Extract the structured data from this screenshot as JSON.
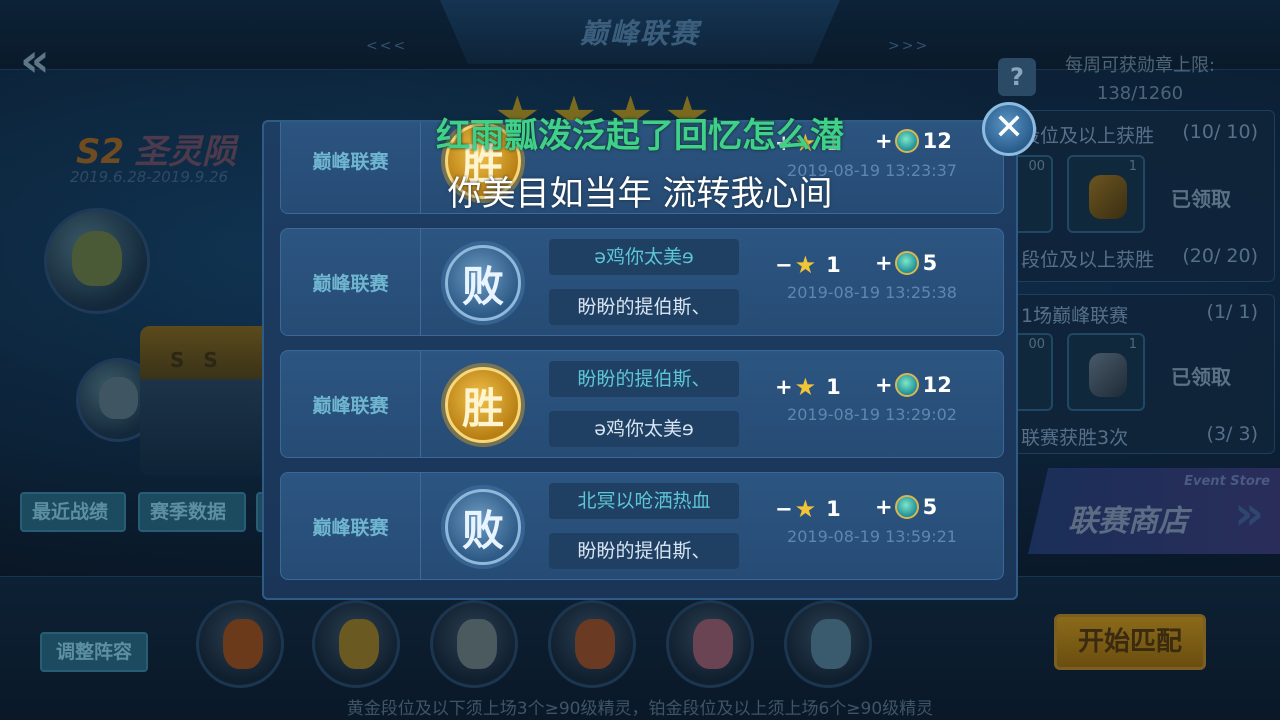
{
  "header": {
    "title": "巅峰联赛",
    "arrows_left": "<<<",
    "arrows_right": ">>>",
    "back_glyph": "«",
    "help_glyph": "?",
    "medal_limit_label": "每周可获勋章上限:",
    "medal_limit_value": "138/1260"
  },
  "season": {
    "code": "S2",
    "name": "圣灵陨",
    "dates": "2019.6.28-2019.9.26"
  },
  "left_tabs": [
    "最近战绩",
    "赛季数据",
    ""
  ],
  "right_panels": {
    "rows": [
      {
        "title": "段位及以上获胜",
        "count": "(10/ 10)",
        "slot_left_num": "00",
        "slot_num": "1",
        "status": "已领取"
      },
      {
        "title": "段位及以上获胜",
        "count": "(20/ 20)"
      },
      {
        "title": "1场巅峰联赛",
        "count": "(1/ 1)",
        "slot_left_num": "00",
        "slot_num": "1",
        "status": "已领取"
      },
      {
        "title": "联赛获胜3次",
        "count": "(3/ 3)"
      }
    ]
  },
  "event_store": {
    "en": "Event Store",
    "cn": "联赛商店"
  },
  "bottom": {
    "adjust_label": "调整阵容",
    "start_label": "开始匹配",
    "footnote": "黄金段位及以下须上场3个≥90级精灵，铂金段位及以上须上场6个≥90级精灵"
  },
  "subtitles": {
    "line1": "红雨瓢泼泛起了回忆怎么潜",
    "line2": "你美目如当年 流转我心间"
  },
  "modal": {
    "close_glyph": "✕",
    "records": [
      {
        "league": "巅峰联赛",
        "result": "胜",
        "outcome": "win",
        "player_top": "",
        "player_bottom": "",
        "star_sign": "+",
        "star_value": "1",
        "gem_value": "12",
        "time": "2019-08-19 13:23:37"
      },
      {
        "league": "巅峰联赛",
        "result": "败",
        "outcome": "lose",
        "player_top": "ə鸡你太美ɘ",
        "player_bottom": "盼盼的提伯斯、",
        "star_sign": "−",
        "star_value": "1",
        "gem_value": "5",
        "time": "2019-08-19 13:25:38"
      },
      {
        "league": "巅峰联赛",
        "result": "胜",
        "outcome": "win",
        "player_top": "盼盼的提伯斯、",
        "player_bottom": "ə鸡你太美ɘ",
        "star_sign": "+",
        "star_value": "1",
        "gem_value": "12",
        "time": "2019-08-19 13:29:02"
      },
      {
        "league": "巅峰联赛",
        "result": "败",
        "outcome": "lose",
        "player_top": "北冥以呛洒热血",
        "player_bottom": "盼盼的提伯斯、",
        "star_sign": "−",
        "star_value": "1",
        "gem_value": "5",
        "time": "2019-08-19 13:59:21"
      }
    ]
  },
  "colors": {
    "win_gold": "#f1c24a",
    "lose_blue": "#6e9bc2",
    "subtitle_green": "#3fd089",
    "modal_bg": "#1e3d63"
  }
}
